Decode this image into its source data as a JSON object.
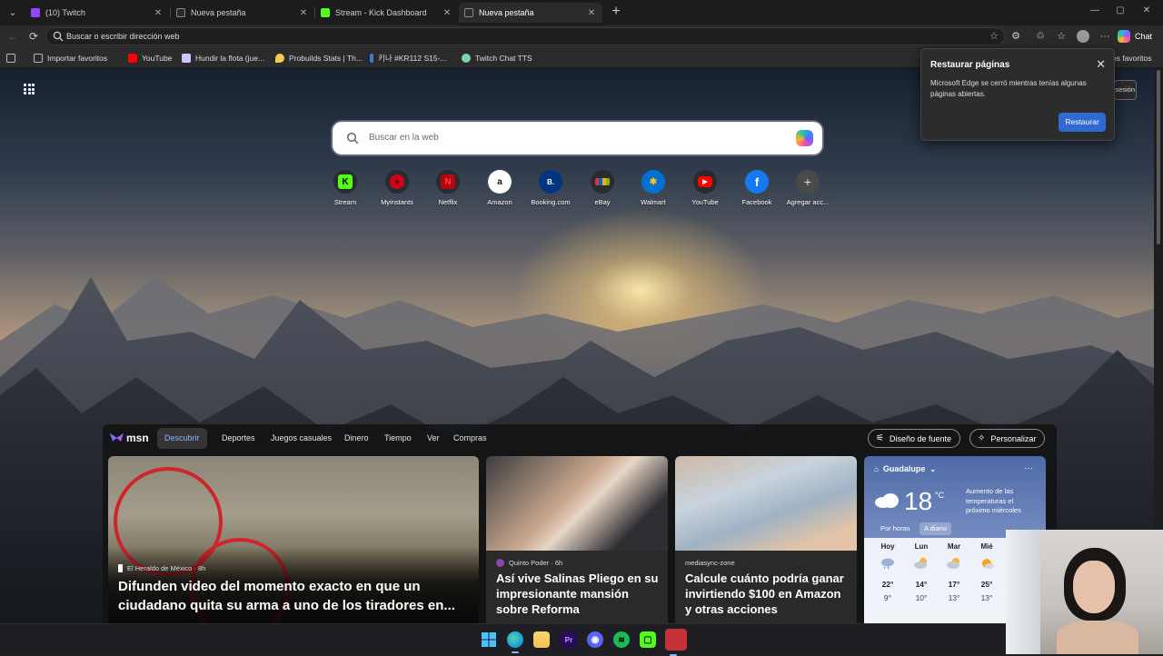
{
  "tabs": [
    {
      "label": "(10) Twitch",
      "favicon_color": "#9146ff",
      "active": false
    },
    {
      "label": "Nueva pestaña",
      "favicon_color": "#6b6b6b",
      "active": false
    },
    {
      "label": "Stream - Kick Dashboard",
      "favicon_color": "#53fc18",
      "active": false
    },
    {
      "label": "Nueva pestaña",
      "favicon_color": "#6b6b6b",
      "active": true
    }
  ],
  "addressbar": {
    "placeholder": "Buscar o escribir dirección web"
  },
  "toolbar": {
    "chat_label": "Chat"
  },
  "bookmarks": [
    {
      "label": "Importar favoritos",
      "icon": "import-icon",
      "color": "#bbbbbb"
    },
    {
      "label": "YouTube",
      "icon": "youtube-icon",
      "color": "#ff0000"
    },
    {
      "label": "Hundir la flota (jue...",
      "icon": "battleship-icon",
      "color": "#c8c8ff"
    },
    {
      "label": "Probuilds Stats | Th...",
      "icon": "probuilds-icon",
      "color": "#f2c94c"
    },
    {
      "label": "키나 #KR112 S15-...",
      "icon": "bookmark-icon",
      "color": "#3a7bd5"
    },
    {
      "label": "Twitch Chat TTS",
      "icon": "tts-icon",
      "color": "#7fd1a8"
    }
  ],
  "bookmarks_other": "os favoritos",
  "ntp": {
    "search_placeholder": "Buscar en la web",
    "signin_label": "sesión",
    "quick_links": [
      {
        "label": "Stream",
        "glyph": "K",
        "bg": "#53fc18",
        "fg": "#000000"
      },
      {
        "label": "Myinstants",
        "glyph": "●",
        "bg": "#d0021b",
        "fg": "#8b0000"
      },
      {
        "label": "Netflix",
        "glyph": "N",
        "bg": "#222222",
        "fg": "#e50914"
      },
      {
        "label": "Amazon",
        "glyph": "a",
        "bg": "#ffffff",
        "fg": "#111111"
      },
      {
        "label": "Booking.com",
        "glyph": "B.",
        "bg": "#003580",
        "fg": "#ffffff"
      },
      {
        "label": "eBay",
        "glyph": "e",
        "bg": "#f5af02",
        "fg": "#0064d2"
      },
      {
        "label": "Walmart",
        "glyph": "✱",
        "bg": "#0071ce",
        "fg": "#ffc220"
      },
      {
        "label": "YouTube",
        "glyph": "▶",
        "bg": "#ff0000",
        "fg": "#ffffff"
      },
      {
        "label": "Facebook",
        "glyph": "f",
        "bg": "#1877f2",
        "fg": "#ffffff"
      },
      {
        "label": "Agregar acc...",
        "glyph": "+",
        "bg": "#3a3a3a",
        "fg": "#dddddd"
      }
    ]
  },
  "msn": {
    "logo": "msn",
    "nav": [
      "Descubrir",
      "Deportes",
      "Juegos casuales",
      "Dinero",
      "Tiempo",
      "Ver",
      "Compras"
    ],
    "font_button": "Diseño de fuente",
    "personalize_button": "Personalizar",
    "cards": [
      {
        "source": "El Heraldo de México · 8h",
        "headline": "Difunden video del momento exacto en que un ciudadano quita su arma a uno de los tiradores en..."
      },
      {
        "source": "Quinto Poder · 6h",
        "headline": "Así vive Salinas Pliego en su impresionante mansión sobre Reforma"
      },
      {
        "source": "mediasync-zone",
        "headline": "Calcule cuánto podría ganar invirtiendo $100 en Amazon y otras acciones"
      }
    ],
    "weather": {
      "location": "Guadalupe",
      "temp": "18",
      "unit": "°C",
      "alert": "Aumento de las temperaturas el próximo miércoles",
      "tabs": [
        "Por horas",
        "A diario"
      ],
      "days": [
        {
          "day": "Hoy",
          "icon": "rain-cloud-icon",
          "high": "22°",
          "low": "9°"
        },
        {
          "day": "Lun",
          "icon": "partly-cloudy-icon",
          "high": "14°",
          "low": "10°"
        },
        {
          "day": "Mar",
          "icon": "partly-cloudy-icon",
          "high": "17°",
          "low": "13°"
        },
        {
          "day": "Mié",
          "icon": "sunny-cloud-icon",
          "high": "25°",
          "low": "13°"
        }
      ]
    }
  },
  "restore_popup": {
    "title": "Restaurar páginas",
    "body": "Microsoft Edge se cerró mientras tenías algunas páginas abiertas.",
    "button": "Restaurar"
  },
  "taskbar": [
    {
      "name": "start-icon",
      "color": "#4cc2ff"
    },
    {
      "name": "edge-icon",
      "color": "#1fa0e0"
    },
    {
      "name": "file-explorer-icon",
      "color": "#f2c14e"
    },
    {
      "name": "premiere-icon",
      "color": "#2a0a5e"
    },
    {
      "name": "discord-icon",
      "color": "#5865f2"
    },
    {
      "name": "spotify-icon",
      "color": "#1db954"
    },
    {
      "name": "kick-app-icon",
      "color": "#53fc18"
    },
    {
      "name": "app-icon",
      "color": "#c4323a"
    }
  ]
}
